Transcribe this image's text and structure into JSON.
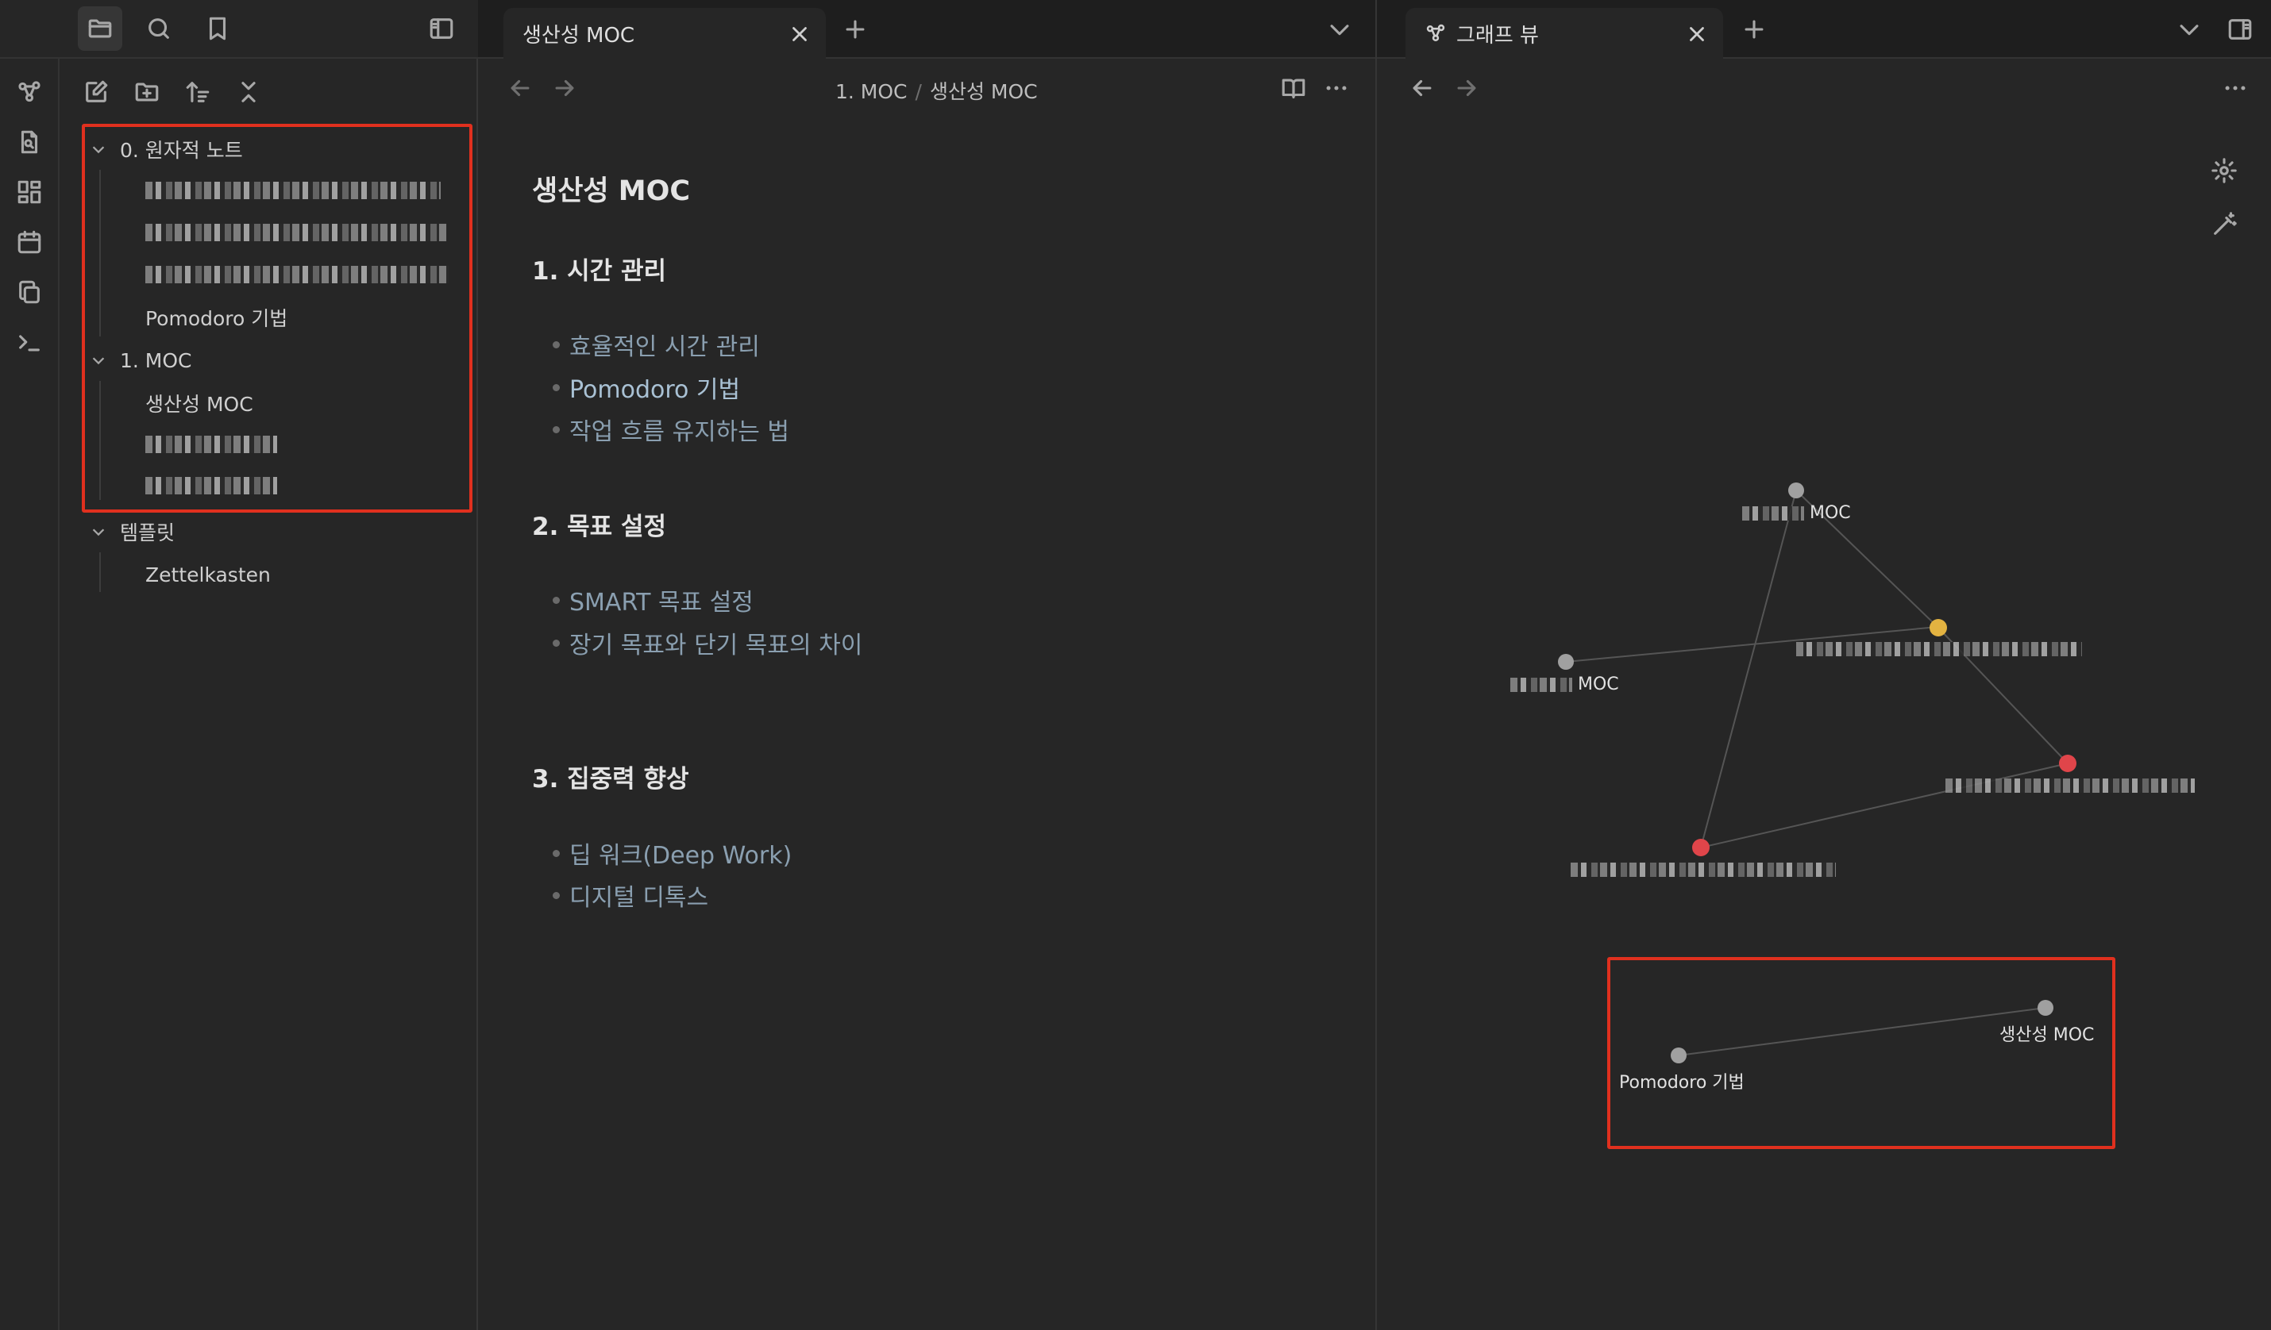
{
  "left_panel": {
    "tab_icons": [
      "folder-icon",
      "search-icon",
      "bookmark-icon"
    ],
    "toolbar_icons": [
      "new-note-icon",
      "new-folder-icon",
      "sort-icon",
      "collapse-icon"
    ],
    "tree": {
      "folder_atomic": "0. 원자적 노트",
      "file_pomodoro": "Pomodoro 기법",
      "folder_moc": "1. MOC",
      "file_productivity": "생산성 MOC",
      "folder_templates": "템플릿",
      "file_zettelkasten": "Zettelkasten"
    }
  },
  "editor": {
    "tab_title": "생산성 MOC",
    "breadcrumb_folder": "1. MOC",
    "breadcrumb_sep": "/",
    "breadcrumb_file": "생산성 MOC",
    "title": "생산성 MOC",
    "sections": [
      {
        "heading": "1. 시간 관리",
        "items": [
          "효율적인 시간 관리",
          "Pomodoro 기법",
          "작업 흐름 유지하는 법"
        ]
      },
      {
        "heading": "2. 목표 설정",
        "items": [
          "SMART 목표 설정",
          "장기 목표와 단기 목표의 차이"
        ]
      },
      {
        "heading": "3. 집중력 향상",
        "items": [
          "딥 워크(Deep Work)",
          "디지털 디톡스"
        ]
      }
    ]
  },
  "graph": {
    "tab_title": "그래프 뷰",
    "labels": {
      "top_suffix": "MOC",
      "left_suffix": "MOC",
      "bottom_left": "Pomodoro 기법",
      "bottom_right": "생산성 MOC"
    },
    "colors": {
      "gray": "#a0a0a0",
      "yellow": "#e3b341",
      "red": "#e0454a"
    }
  },
  "colors": {
    "highlight": "#e0301e",
    "background": "#262626"
  }
}
